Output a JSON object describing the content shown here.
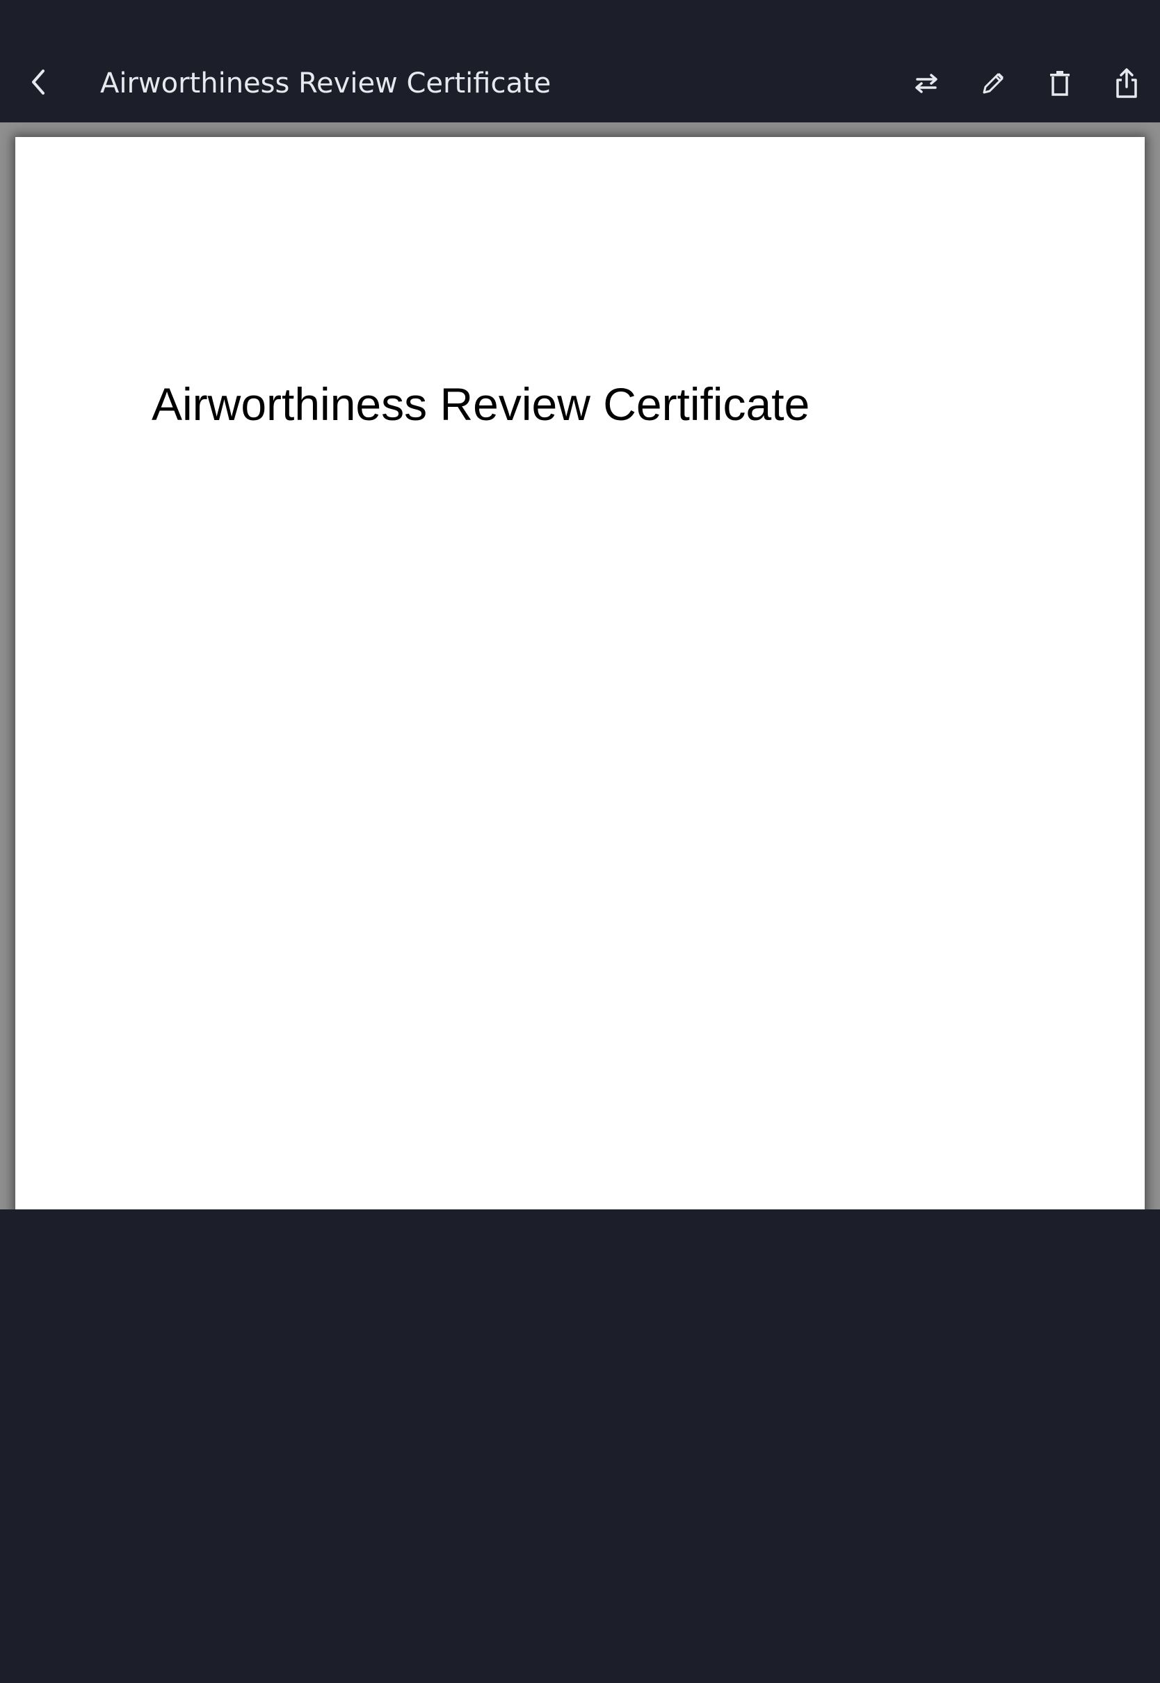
{
  "header": {
    "title": "Airworthiness Review Certificate",
    "back_icon": "chevron-left-icon",
    "actions": [
      {
        "icon": "swap-icon"
      },
      {
        "icon": "pencil-icon"
      },
      {
        "icon": "trash-icon"
      },
      {
        "icon": "share-icon"
      }
    ]
  },
  "document": {
    "heading": "Airworthiness Review Certificate"
  },
  "colors": {
    "toolbar_bg": "#1c1f2a",
    "toolbar_text": "#e7e9ef",
    "page_bg": "#ffffff",
    "page_surround": "#8f8f8f"
  }
}
